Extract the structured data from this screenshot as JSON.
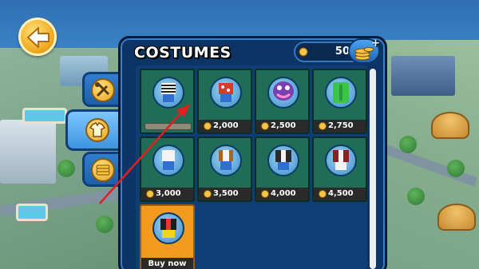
{
  "header": {
    "title": "COSTUMES",
    "coins": "50"
  },
  "side_tabs": [
    {
      "name": "tools",
      "icon": "wrench-hammer-icon"
    },
    {
      "name": "costumes",
      "icon": "shirt-icon",
      "active": true
    },
    {
      "name": "coins",
      "icon": "coin-stack-icon"
    }
  ],
  "costumes": [
    {
      "id": "striped-shirt",
      "state": "owned",
      "price": ""
    },
    {
      "id": "hawaiian-shirt",
      "state": "buy",
      "price": "2,000"
    },
    {
      "id": "purple-monster",
      "state": "buy",
      "price": "2,500"
    },
    {
      "id": "green-suit",
      "state": "buy",
      "price": "2,750"
    },
    {
      "id": "white-vest",
      "state": "buy",
      "price": "3,000"
    },
    {
      "id": "brown-vest",
      "state": "buy",
      "price": "3,500"
    },
    {
      "id": "black-jacket",
      "state": "buy",
      "price": "4,000"
    },
    {
      "id": "red-jacket",
      "state": "buy",
      "price": "4,500"
    },
    {
      "id": "yellow-jacket",
      "state": "featured",
      "label": "Buy now"
    }
  ],
  "colors": {
    "card_bg": "#1f6d57",
    "featured_bg": "#f19a1e",
    "panel_bg": "#0c3566",
    "arrow": "#e02020"
  }
}
